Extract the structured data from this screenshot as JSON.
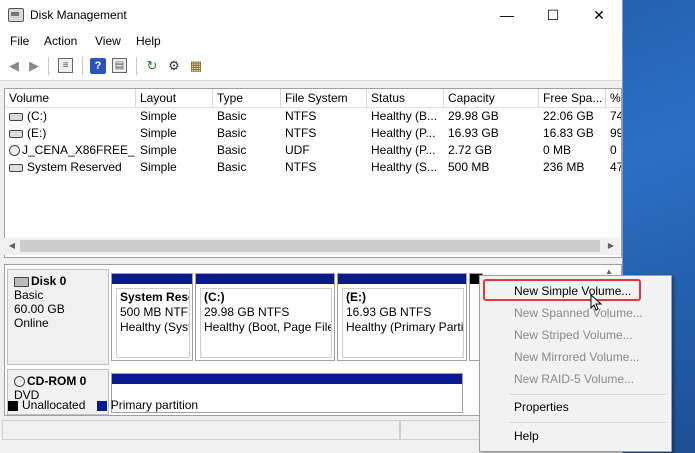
{
  "window": {
    "title": "Disk Management",
    "minimize": "—",
    "maximize": "☐",
    "close": "✕"
  },
  "menu": [
    "File",
    "Action",
    "View",
    "Help"
  ],
  "toolbar": {
    "icons": [
      "back-arrow",
      "forward-arrow",
      "disk-list",
      "help",
      "properties",
      "refresh",
      "settings",
      "rescan"
    ]
  },
  "volume_list": {
    "columns": [
      "Volume",
      "Layout",
      "Type",
      "File System",
      "Status",
      "Capacity",
      "Free Spa...",
      "%"
    ],
    "rows": [
      {
        "volume": "(C:)",
        "layout": "Simple",
        "type": "Basic",
        "fs": "NTFS",
        "status": "Healthy (B...",
        "capacity": "29.98 GB",
        "free": "22.06 GB",
        "pct": "74"
      },
      {
        "volume": "(E:)",
        "layout": "Simple",
        "type": "Basic",
        "fs": "NTFS",
        "status": "Healthy (P...",
        "capacity": "16.93 GB",
        "free": "16.83 GB",
        "pct": "99"
      },
      {
        "volume": "J_CENA_X86FREE_...",
        "layout": "Simple",
        "type": "Basic",
        "fs": "UDF",
        "status": "Healthy (P...",
        "capacity": "2.72 GB",
        "free": "0 MB",
        "pct": "0"
      },
      {
        "volume": "System Reserved",
        "layout": "Simple",
        "type": "Basic",
        "fs": "NTFS",
        "status": "Healthy (S...",
        "capacity": "500 MB",
        "free": "236 MB",
        "pct": "47"
      }
    ]
  },
  "disks": [
    {
      "name": "Disk 0",
      "type": "Basic",
      "size": "60.00 GB",
      "state": "Online",
      "partitions": [
        {
          "name": "System Rese",
          "detail": "500 MB NTFS",
          "status": "Healthy (Syst"
        },
        {
          "name": "(C:)",
          "detail": "29.98 GB NTFS",
          "status": "Healthy (Boot, Page File"
        },
        {
          "name": "(E:)",
          "detail": "16.93 GB NTFS",
          "status": "Healthy (Primary Partiti"
        }
      ]
    },
    {
      "name": "CD-ROM 0",
      "type": "DVD"
    }
  ],
  "legend": {
    "unallocated": "Unallocated",
    "primary": "Primary partition",
    "unallocated_color": "#000000",
    "primary_color": "#0a1b8f"
  },
  "context_menu": {
    "items": [
      {
        "label": "New Simple Volume...",
        "enabled": true
      },
      {
        "label": "New Spanned Volume...",
        "enabled": false
      },
      {
        "label": "New Striped Volume...",
        "enabled": false
      },
      {
        "label": "New Mirrored Volume...",
        "enabled": false
      },
      {
        "label": "New RAID-5 Volume...",
        "enabled": false
      },
      {
        "label": "Properties",
        "enabled": true
      },
      {
        "label": "Help",
        "enabled": true
      }
    ],
    "highlight_color": "#e03b3b"
  }
}
